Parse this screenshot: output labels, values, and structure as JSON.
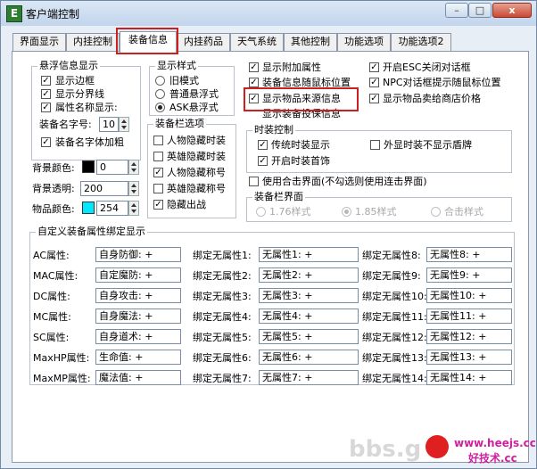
{
  "window": {
    "title": "客户端控制",
    "app_icon_glyph": "E",
    "min_glyph": "–",
    "max_glyph": "□",
    "close_glyph": "x"
  },
  "tabs": [
    "界面显示",
    "内挂控制",
    "装备信息",
    "内挂药品",
    "天气系统",
    "其他控制",
    "功能选项",
    "功能选项2"
  ],
  "active_tab": "装备信息",
  "float_info": {
    "title": "悬浮信息显示",
    "show_border": {
      "label": "显示边框",
      "checked": true
    },
    "show_divider": {
      "label": "显示分界线",
      "checked": true
    },
    "attr_name": {
      "label": "属性名称显示:",
      "checked": true
    },
    "font_size_label": "装备名字号:",
    "font_size_value": "10",
    "bold": {
      "label": "装备名字体加粗",
      "checked": true
    }
  },
  "style": {
    "title": "显示样式",
    "options": [
      {
        "label": "旧模式",
        "selected": false
      },
      {
        "label": "普通悬浮式",
        "selected": false
      },
      {
        "label": "ASK悬浮式",
        "selected": true
      }
    ]
  },
  "colors": {
    "bg_color_label": "背景颜色:",
    "bg_color_value": "0",
    "bg_swatch": "#000000",
    "bg_alpha_label": "背景透明:",
    "bg_alpha_value": "200",
    "item_color_label": "物品颜色:",
    "item_color_value": "254",
    "item_swatch": "#00e8ff"
  },
  "equip_bar_opts": {
    "title": "装备栏选项",
    "items": [
      {
        "label": "人物隐藏时装",
        "checked": false
      },
      {
        "label": "英雄隐藏时装",
        "checked": false
      },
      {
        "label": "人物隐藏称号",
        "checked": true
      },
      {
        "label": "英雄隐藏称号",
        "checked": false
      },
      {
        "label": "隐藏出战",
        "checked": true
      }
    ]
  },
  "right_top": {
    "show_extra": {
      "label": "显示附加属性",
      "checked": true
    },
    "follow_mouse": {
      "label": "装备信息随鼠标位置",
      "checked": true
    },
    "show_source": {
      "label": "显示物品来源信息",
      "checked": true
    },
    "show_durability": {
      "label": "显示装备投保信息",
      "checked": false
    },
    "esc_close": {
      "label": "开启ESC关闭对话框",
      "checked": true
    },
    "npc_tip": {
      "label": "NPC对话框提示随鼠标位置",
      "checked": true
    },
    "sell_price": {
      "label": "显示物品卖给商店价格",
      "checked": true
    }
  },
  "fashion": {
    "title": "时装控制",
    "items": [
      {
        "label": "传统时装显示",
        "checked": true
      },
      {
        "label": "外显时装不显示盾牌",
        "checked": false
      },
      {
        "label": "开启时装首饰",
        "checked": true
      }
    ]
  },
  "use_combined": {
    "label": "使用合击界面(不勾选则使用连击界面)",
    "checked": false
  },
  "equip_ui": {
    "title": "装备栏界面",
    "options": [
      {
        "label": "1.76样式",
        "selected": false
      },
      {
        "label": "1.85样式",
        "selected": true
      },
      {
        "label": "合击样式",
        "selected": false
      }
    ]
  },
  "custom": {
    "title": "自定义装备属性绑定显示",
    "rows": [
      {
        "name": "AC属性:",
        "value": "自身防御: +",
        "b1": "绑定无属性1:",
        "v1": "无属性1: +",
        "b2": "绑定无属性8:",
        "v2": "无属性8: +"
      },
      {
        "name": "MAC属性:",
        "value": "自定魔防: +",
        "b1": "绑定无属性2:",
        "v1": "无属性2: +",
        "b2": "绑定无属性9:",
        "v2": "无属性9: +"
      },
      {
        "name": "DC属性:",
        "value": "自身攻击: +",
        "b1": "绑定无属性3:",
        "v1": "无属性3: +",
        "b2": "绑定无属性10:",
        "v2": "无属性10: +"
      },
      {
        "name": "MC属性:",
        "value": "自身魔法: +",
        "b1": "绑定无属性4:",
        "v1": "无属性4: +",
        "b2": "绑定无属性11:",
        "v2": "无属性11: +"
      },
      {
        "name": "SC属性:",
        "value": "自身道术: +",
        "b1": "绑定无属性5:",
        "v1": "无属性5: +",
        "b2": "绑定无属性12:",
        "v2": "无属性12: +"
      },
      {
        "name": "MaxHP属性:",
        "value": "生命值: +",
        "b1": "绑定无属性6:",
        "v1": "无属性6: +",
        "b2": "绑定无属性13:",
        "v2": "无属性13: +"
      },
      {
        "name": "MaxMP属性:",
        "value": "魔法值: +",
        "b1": "绑定无属性7:",
        "v1": "无属性7: +",
        "b2": "绑定无属性14:",
        "v2": "无属性14: +"
      }
    ]
  },
  "watermark": {
    "left": "bbs.g",
    "site": "www.heejs.cc",
    "site2": "好技术.cc"
  }
}
